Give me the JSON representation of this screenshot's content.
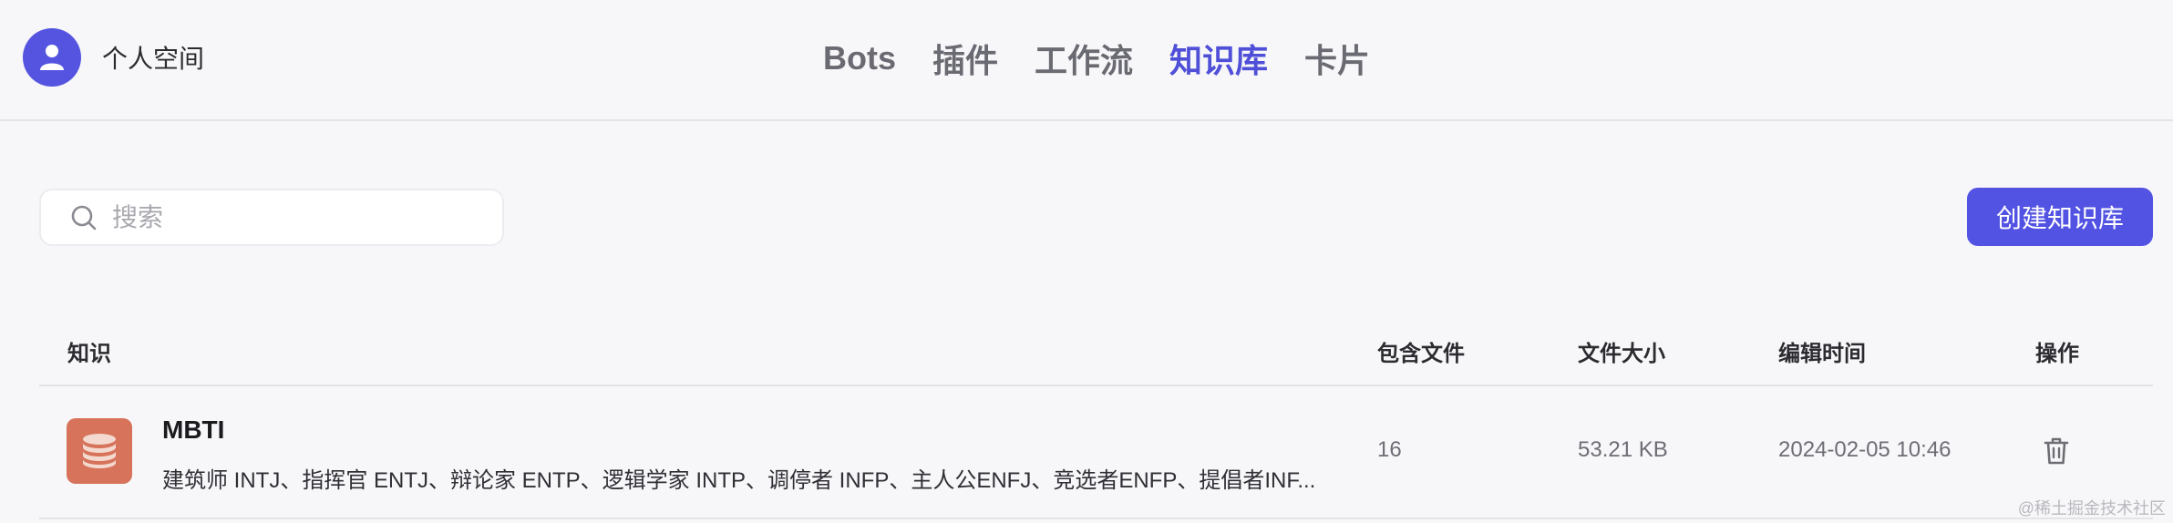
{
  "user": {
    "name": "个人空间",
    "avatar_icon": "user-icon"
  },
  "nav": {
    "items": [
      {
        "label": "Bots",
        "active": false
      },
      {
        "label": "插件",
        "active": false
      },
      {
        "label": "工作流",
        "active": false
      },
      {
        "label": "知识库",
        "active": true
      },
      {
        "label": "卡片",
        "active": false
      }
    ]
  },
  "search": {
    "placeholder": "搜索",
    "value": "",
    "icon": "search-icon"
  },
  "create_button": {
    "label": "创建知识库"
  },
  "table": {
    "headers": {
      "knowledge": "知识",
      "files": "包含文件",
      "size": "文件大小",
      "edited": "编辑时间",
      "actions": "操作"
    },
    "rows": [
      {
        "icon": "database-icon",
        "title": "MBTI",
        "description": "建筑师 INTJ、指挥官 ENTJ、辩论家 ENTP、逻辑学家 INTP、调停者 INFP、主人公ENFJ、竞选者ENFP、提倡者INF...",
        "files": "16",
        "size": "53.21 KB",
        "edited": "2024-02-05 10:46",
        "action_icon": "trash-icon"
      }
    ]
  },
  "watermark": "@稀土掘金技术社区",
  "colors": {
    "accent": "#5252e3",
    "active_nav": "#4f4fd8",
    "kb_icon_bg": "#d6735a",
    "background": "#f7f7f9"
  }
}
